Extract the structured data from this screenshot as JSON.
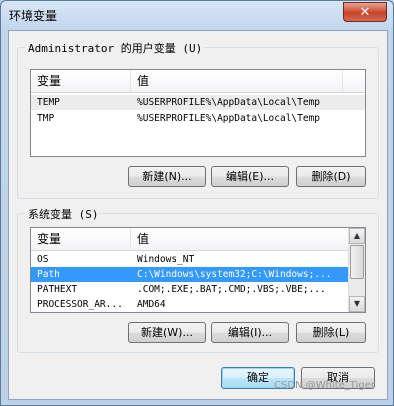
{
  "window": {
    "title": "环境变量",
    "close_glyph": "✕"
  },
  "user_vars": {
    "group_label": "Administrator 的用户变量 (U)",
    "columns": [
      "变量",
      "值"
    ],
    "rows": [
      {
        "name": "TEMP",
        "value": "%USERPROFILE%\\AppData\\Local\\Temp"
      },
      {
        "name": "TMP",
        "value": "%USERPROFILE%\\AppData\\Local\\Temp"
      }
    ],
    "buttons": {
      "new": "新建(N)...",
      "edit": "编辑(E)...",
      "delete": "删除(D)"
    }
  },
  "system_vars": {
    "group_label": "系统变量 (S)",
    "columns": [
      "变量",
      "值"
    ],
    "rows": [
      {
        "name": "OS",
        "value": "Windows_NT"
      },
      {
        "name": "Path",
        "value": "C:\\Windows\\system32;C:\\Windows;..."
      },
      {
        "name": "PATHEXT",
        "value": ".COM;.EXE;.BAT;.CMD;.VBS;.VBE;..."
      },
      {
        "name": "PROCESSOR_AR...",
        "value": "AMD64"
      }
    ],
    "selected_row": "Path",
    "buttons": {
      "new": "新建(W)...",
      "edit": "编辑(I)...",
      "delete": "删除(L)"
    }
  },
  "footer": {
    "ok": "确定",
    "cancel": "取消"
  },
  "watermark": "CSDN @White_Tiger",
  "colors": {
    "selection": "#3399ff",
    "close_button": "#c8432a"
  }
}
